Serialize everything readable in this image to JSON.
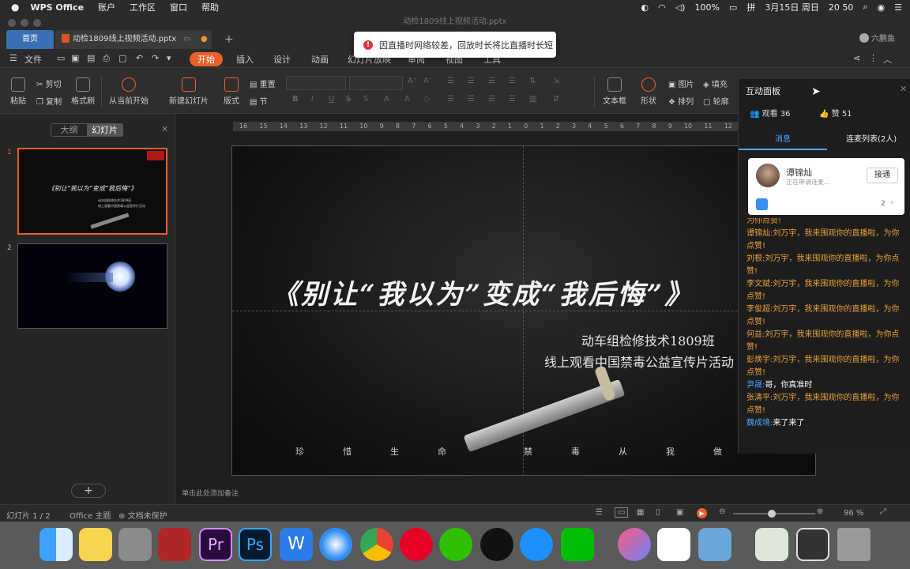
{
  "menubar": {
    "app": "WPS Office",
    "items": [
      "账户",
      "工作区",
      "窗口",
      "帮助"
    ],
    "battery": "100%",
    "date": "3月15日 周日",
    "time": "20 50"
  },
  "window": {
    "title": "动检1809线上视频活动.pptx"
  },
  "tabs": {
    "home": "首页",
    "doc": "动检1809线上视频活动.pptx",
    "user": "六鹏鱼"
  },
  "notice": "因直播时网络较差，回放时长将比直播时长短",
  "ribbon_tabs": {
    "file": "文件",
    "items": [
      "开始",
      "插入",
      "设计",
      "动画",
      "幻灯片放映",
      "审阅",
      "视图",
      "工具"
    ]
  },
  "ribbon": {
    "paste": "粘贴",
    "cut": "剪切",
    "copy": "复制",
    "format_painter": "格式刷",
    "from_current": "从当前开始",
    "new_slide": "新建幻灯片",
    "layout": "版式",
    "reset": "重置",
    "section": "节",
    "textbox": "文本框",
    "shape": "形状",
    "picture": "图片",
    "fill": "填充",
    "arrange": "排列",
    "outline": "轮廓"
  },
  "leftpane": {
    "outline": "大纲",
    "slides": "幻灯片",
    "add": "+",
    "thumbs": [
      {
        "num": "1"
      },
      {
        "num": "2"
      }
    ]
  },
  "ruler": [
    "16",
    "15",
    "14",
    "13",
    "12",
    "11",
    "10",
    "9",
    "8",
    "7",
    "6",
    "5",
    "4",
    "3",
    "2",
    "1",
    "0",
    "1",
    "2",
    "3",
    "4",
    "5",
    "6",
    "7",
    "8",
    "9",
    "10",
    "11",
    "12"
  ],
  "slide": {
    "title": "《别让“我以为”变成“我后悔”》",
    "line1": "动车组检修技术1809班",
    "line2": "线上观看中国禁毒公益宣传片活动",
    "motto": [
      "珍",
      "惜",
      "生",
      "命",
      "",
      "禁",
      "毒",
      "从",
      "我",
      "做"
    ]
  },
  "thumb1": {
    "title": "《别让“我以为”变成“我后悔”》",
    "sub1": "动车组检修技术1809班",
    "sub2": "线上观看中国禁毒公益宣传片活动"
  },
  "notes_placeholder": "单击此处添加备注",
  "panel": {
    "title": "互动面板",
    "views": "观看 36",
    "likes": "赞 51",
    "tab_messages": "消息",
    "tab_connect": "连麦列表(2人)",
    "request": {
      "name": "谭锦灿",
      "status": "正在申请连麦...",
      "action": "接通",
      "count": "2"
    },
    "messages": [
      {
        "name": "",
        "text": "为你点赞!"
      },
      {
        "name": "谭锦灿:",
        "text": "刘万宇，我来围观你的直播啦，为你点赞!"
      },
      {
        "name": "刘根:",
        "text": "刘万宇，我来围观你的直播啦，为你点赞!"
      },
      {
        "name": "李文斌:",
        "text": "刘万宇，我来围观你的直播啦，为你点赞!"
      },
      {
        "name": "李俊超:",
        "text": "刘万宇，我来围观你的直播啦，为你点赞!"
      },
      {
        "name": "何益:",
        "text": "刘万宇，我来围观你的直播啦，为你点赞!"
      },
      {
        "name": "彭焕宇:",
        "text": "刘万宇，我来围观你的直播啦，为你点赞!"
      },
      {
        "name": "尹晟:",
        "text": "哥，你真准时",
        "blue": true
      },
      {
        "name": "张清平:",
        "text": "刘万宇，我来围观你的直播啦，为你点赞!"
      },
      {
        "name": "魏成境:",
        "text": "来了来了",
        "blue": true
      }
    ]
  },
  "status": {
    "slide": "幻灯片 1 / 2",
    "theme": "Office 主题",
    "protect": "文档未保护",
    "zoom": "96 %"
  }
}
